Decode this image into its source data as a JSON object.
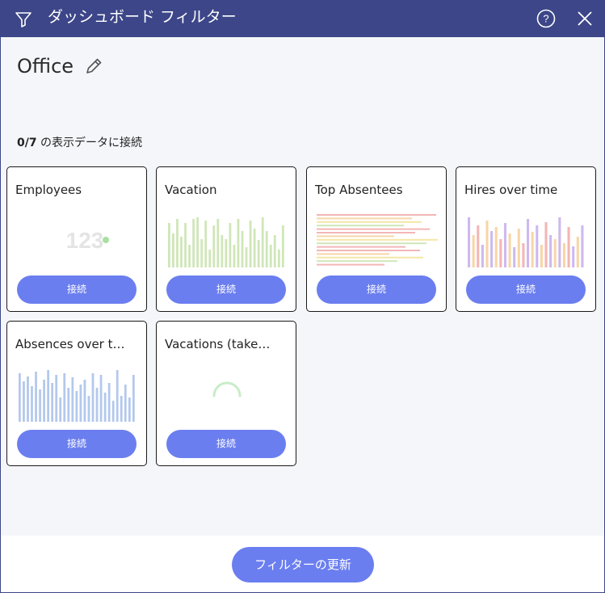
{
  "dialog": {
    "title": "ダッシュボード フィルター",
    "icons": {
      "filter": "filter-icon",
      "help": "help-icon",
      "close": "close-icon"
    }
  },
  "dashboard": {
    "name": "Office",
    "edit_icon": "pencil-icon"
  },
  "connected": {
    "count": "0/7",
    "suffix": " の表示データに接続"
  },
  "connect_label": "接続",
  "cards": [
    {
      "title": "Employees",
      "preview": "kpi",
      "kpi_text": "123"
    },
    {
      "title": "Vacation",
      "preview": "bars-green"
    },
    {
      "title": "Top Absentees",
      "preview": "hbars"
    },
    {
      "title": "Hires over time",
      "preview": "bars-multi"
    },
    {
      "title": "Absences over t…",
      "preview": "bars-blue"
    },
    {
      "title": "Vacations (take…",
      "preview": "loading"
    }
  ],
  "footer": {
    "refresh_label": "フィルターの更新"
  },
  "colors": {
    "header": "#3c4688",
    "button": "#6b7ef0",
    "green_bars": "#cfe6b8",
    "blue_bars": "#b3c8ec",
    "kpi_dot": "#a8e0a0"
  }
}
